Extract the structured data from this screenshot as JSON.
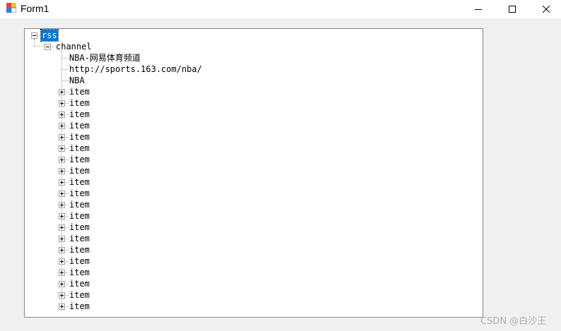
{
  "window": {
    "title": "Form1",
    "minimize_icon": "minimize-icon",
    "maximize_icon": "maximize-icon",
    "close_icon": "close-icon"
  },
  "tree": {
    "root": {
      "label": "rss",
      "expanded": true,
      "selected": true
    },
    "channel": {
      "label": "channel",
      "expanded": true
    },
    "channel_children": [
      {
        "label": "NBA-网易体育频道"
      },
      {
        "label": "http://sports.163.com/nba/"
      },
      {
        "label": "NBA"
      }
    ],
    "items": [
      {
        "label": "item"
      },
      {
        "label": "item"
      },
      {
        "label": "item"
      },
      {
        "label": "item"
      },
      {
        "label": "item"
      },
      {
        "label": "item"
      },
      {
        "label": "item"
      },
      {
        "label": "item"
      },
      {
        "label": "item"
      },
      {
        "label": "item"
      },
      {
        "label": "item"
      },
      {
        "label": "item"
      },
      {
        "label": "item"
      },
      {
        "label": "item"
      },
      {
        "label": "item"
      },
      {
        "label": "item"
      },
      {
        "label": "item"
      },
      {
        "label": "item"
      },
      {
        "label": "item"
      },
      {
        "label": "item"
      }
    ]
  },
  "watermark": "CSDN @白沙王"
}
